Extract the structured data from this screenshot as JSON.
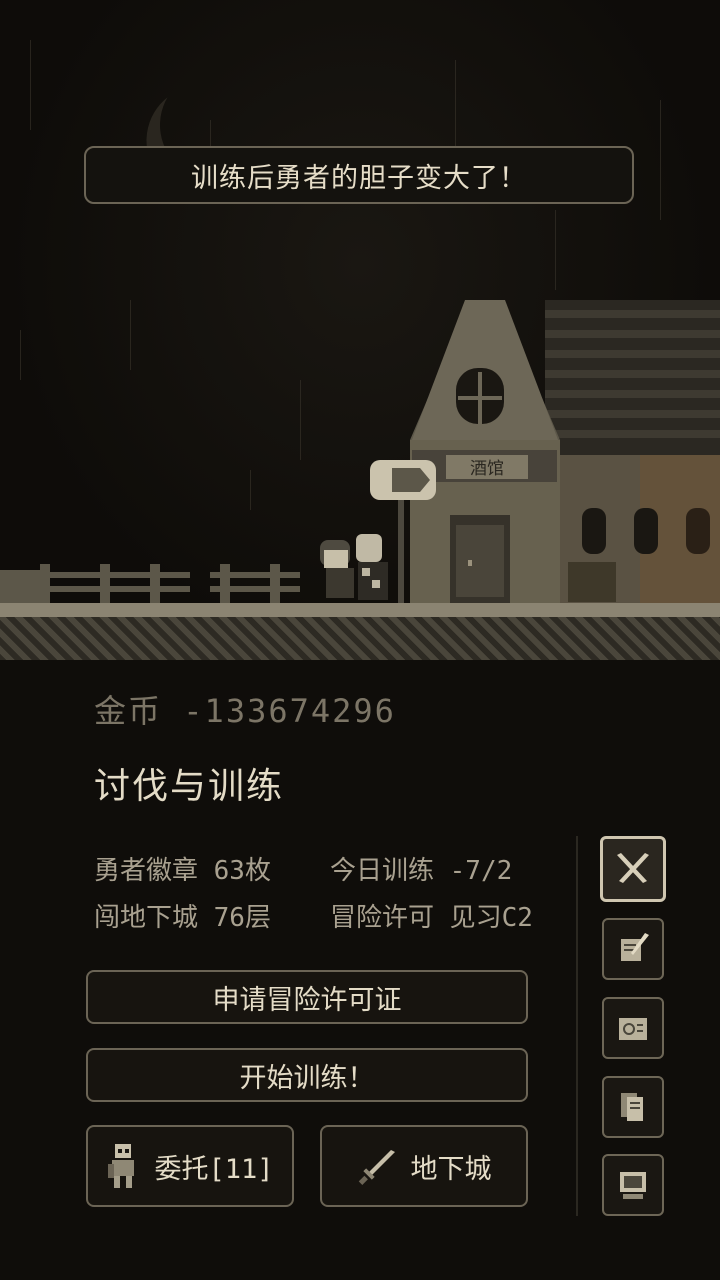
{
  "banner": {
    "message": "训练后勇者的胆子变大了！"
  },
  "scene": {
    "tavern_sign": "酒馆"
  },
  "gold": {
    "label": "金币",
    "value": "-133674296"
  },
  "section_title": "讨伐与训练",
  "stats": {
    "hero_badges": "勇者徽章 63枚",
    "today_training": "今日训练 -7/2",
    "dungeon_floor": "闯地下城 76层",
    "adventure_license": "冒险许可 见习C2"
  },
  "buttons": {
    "apply_license": "申请冒险许可证",
    "start_training": "开始训练！",
    "commission": "委托[11]",
    "dungeon": "地下城"
  },
  "side_menu": [
    {
      "icon": "crossed-swords-icon",
      "active": true
    },
    {
      "icon": "quill-scroll-icon",
      "active": false
    },
    {
      "icon": "map-icon",
      "active": false
    },
    {
      "icon": "documents-icon",
      "active": false
    },
    {
      "icon": "computer-icon",
      "active": false
    }
  ],
  "colors": {
    "background": "#0f0d0a",
    "text": "#e4dcc7",
    "muted": "#a9a190",
    "border": "#6b6455"
  }
}
